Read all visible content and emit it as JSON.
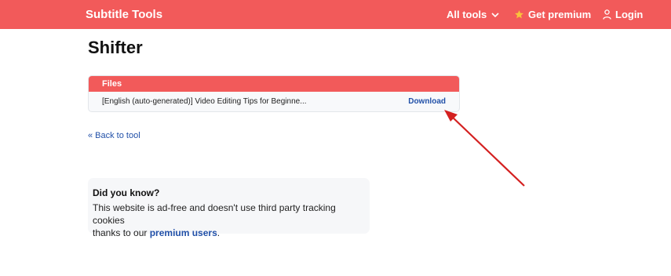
{
  "nav": {
    "brand": "Subtitle Tools",
    "all_tools": "All tools",
    "get_premium": "Get premium",
    "login": "Login"
  },
  "page": {
    "title": "Shifter"
  },
  "files": {
    "header": "Files",
    "rows": [
      {
        "name": "[English (auto-generated)] Video Editing Tips for Beginne...",
        "action": "Download"
      }
    ]
  },
  "back_link": "« Back to tool",
  "info": {
    "title": "Did you know?",
    "text_line1": "This website is ad-free and doesn't use third party tracking cookies",
    "text_before_link": "thanks to our ",
    "link_text": "premium users",
    "text_after_link": "."
  },
  "colors": {
    "brand": "#f25a5a",
    "link": "#2150a8",
    "annotation_arrow": "#d42020"
  },
  "icons": {
    "all_tools": "chevron-down-icon",
    "get_premium": "star-icon",
    "login": "user-icon"
  }
}
